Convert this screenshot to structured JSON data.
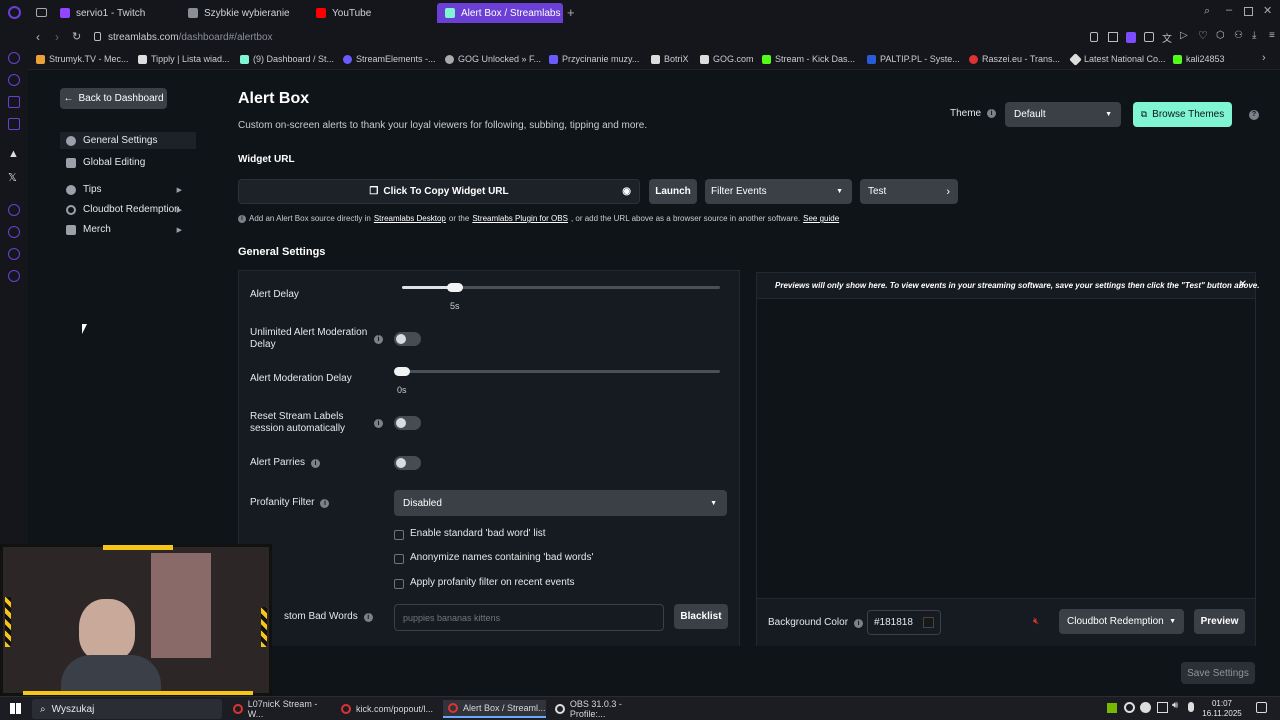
{
  "browser": {
    "tabs": [
      {
        "label": "servio1 - Twitch",
        "color": "#9146ff"
      },
      {
        "label": "Szybkie wybieranie",
        "color": "#8a8f96"
      },
      {
        "label": "YouTube",
        "color": "#ff0000"
      },
      {
        "label": "Alert Box / Streamlabs",
        "color": "#80f5d2"
      }
    ],
    "url_host": "streamlabs.com",
    "url_path": "/dashboard#/alertbox",
    "bookmarks": [
      "Strumyk.TV - Mec...",
      "Tipply | Lista wiad...",
      "(9) Dashboard / St...",
      "StreamElements -...",
      "GOG Unlocked » F...",
      "Przycinanie muzy...",
      "BotriX",
      "GOG.com",
      "Stream - Kick Das...",
      "PALTIP.PL - Syste...",
      "Raszei.eu - Trans...",
      "Latest National Co...",
      "kali24853"
    ]
  },
  "sidebar": {
    "back_label": "Back to Dashboard",
    "items": [
      {
        "label": "General Settings"
      },
      {
        "label": "Global Editing"
      },
      {
        "label": "Tips"
      },
      {
        "label": "Cloudbot Redemption"
      },
      {
        "label": "Merch"
      }
    ]
  },
  "header": {
    "title": "Alert Box",
    "subtitle": "Custom on-screen alerts to thank your loyal viewers for following, subbing, tipping and more.",
    "theme_label": "Theme",
    "theme_value": "Default",
    "browse_themes": "Browse Themes"
  },
  "widget": {
    "label": "Widget URL",
    "copy_label": "Click To Copy Widget URL",
    "launch": "Launch",
    "filter_events": "Filter Events",
    "test": "Test",
    "help_a": "Add an Alert Box source directly in",
    "help_link1": "Streamlabs Desktop",
    "help_b": "or the",
    "help_link2": "Streamlabs Plugin for OBS",
    "help_c": ", or add the URL above as a browser source in another software.",
    "help_link3": "See guide"
  },
  "settings": {
    "section_title": "General Settings",
    "alert_delay_label": "Alert Delay",
    "alert_delay_value": "5s",
    "unlimited_label": "Unlimited Alert Moderation Delay",
    "moderation_delay_label": "Alert Moderation Delay",
    "moderation_delay_value": "0s",
    "reset_labels_label": "Reset Stream Labels session automatically",
    "alert_parries_label": "Alert Parries",
    "profanity_label": "Profanity Filter",
    "profanity_value": "Disabled",
    "checkbox_1": "Enable standard 'bad word' list",
    "checkbox_2": "Anonymize names containing 'bad words'",
    "checkbox_3": "Apply profanity filter on recent events",
    "custom_bad_words_label": "stom Bad Words",
    "bad_words_placeholder": "puppies bananas kittens",
    "blacklist": "Blacklist"
  },
  "preview": {
    "notice": "Previews will only show here. To view events in your streaming software, save your settings then click the \"Test\" button above.",
    "bg_color_label": "Background Color",
    "bg_color_value": "#181818",
    "cloudbot_select": "Cloudbot Redemption",
    "preview_button": "Preview",
    "save_settings": "Save Settings"
  },
  "taskbar": {
    "search": "Wyszukaj",
    "apps": [
      "L07nicK Stream - W...",
      "kick.com/popout/l...",
      "Alert Box / Streaml...",
      "OBS 31.0.3 - Profile:..."
    ],
    "time": "01:07",
    "date": "16.11.2025"
  },
  "colors": {
    "accent": "#80f5d2",
    "browser_accent": "#6b3fd6",
    "panel": "#151b20"
  }
}
